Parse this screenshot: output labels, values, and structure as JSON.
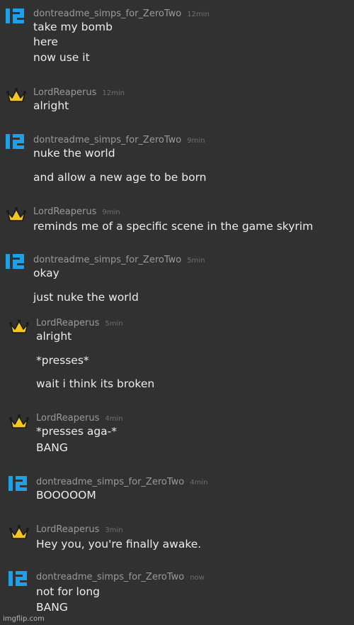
{
  "messages": [
    {
      "user": "dontreadme_simps_for_ZeroTwo",
      "avatar_icon": "blue-z-logo-icon",
      "time": "12min",
      "lines": [
        "take my bomb",
        "here",
        "now use it"
      ]
    },
    {
      "user": "LordReaperus",
      "avatar_icon": "crown-icon",
      "time": "12min",
      "lines": [
        "alright"
      ]
    },
    {
      "user": "dontreadme_simps_for_ZeroTwo",
      "avatar_icon": "blue-z-logo-icon",
      "time": "9min",
      "lines": [
        "nuke the world",
        "and allow a new age to be born"
      ]
    },
    {
      "user": "LordReaperus",
      "avatar_icon": "crown-icon",
      "time": "9min",
      "lines": [
        "reminds me of a specific scene in the game skyrim"
      ]
    },
    {
      "user": "dontreadme_simps_for_ZeroTwo",
      "avatar_icon": "blue-z-logo-icon",
      "time": "5min",
      "lines": [
        "okay",
        "just nuke the world"
      ]
    },
    {
      "user": "LordReaperus",
      "avatar_icon": "crown-icon",
      "time": "5min",
      "lines": [
        "alright",
        "*presses*",
        "wait i think its broken"
      ]
    },
    {
      "user": "LordReaperus",
      "avatar_icon": "crown-icon",
      "time": "4min",
      "lines": [
        "*presses aga-*",
        "BANG"
      ]
    },
    {
      "user": "dontreadme_simps_for_ZeroTwo",
      "avatar_icon": "blue-z-logo-icon",
      "time": "4min",
      "lines": [
        "BOOOOOM"
      ]
    },
    {
      "user": "LordReaperus",
      "avatar_icon": "crown-icon",
      "time": "3min",
      "lines": [
        "Hey you, you're finally awake."
      ]
    },
    {
      "user": "dontreadme_simps_for_ZeroTwo",
      "avatar_icon": "blue-z-logo-icon",
      "time": "now",
      "lines": [
        "not for long",
        "BANG"
      ]
    }
  ],
  "watermark": "imgflip.com",
  "colors": {
    "background": "#313131",
    "username": "#9a9a9a",
    "timestamp": "#6f6f6f",
    "message_text": "#ececec",
    "z_logo_blue": "#1ea0e6",
    "crown_gold": "#f3c81b"
  }
}
